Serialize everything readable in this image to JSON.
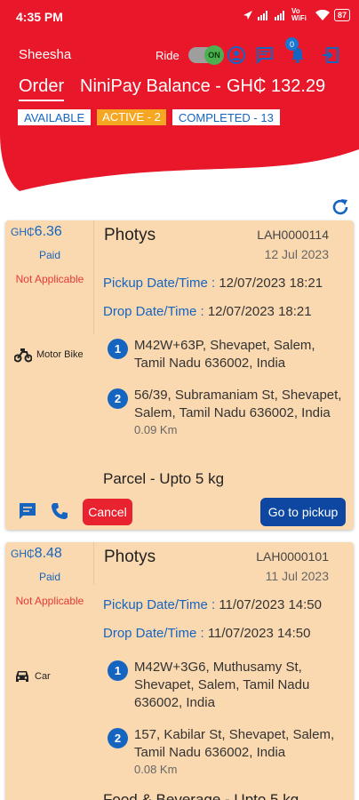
{
  "status_bar": {
    "time": "4:35 PM",
    "network": "Vo WiFi",
    "battery": "87"
  },
  "header": {
    "app_name": "Sheesha",
    "ride_label": "Ride",
    "toggle_label": "ON",
    "notification_count": "0",
    "order_tab": "Order",
    "balance_label": "NiniPay Balance -",
    "balance_value": "GH₵ 132.29",
    "chips": {
      "available": "AVAILABLE",
      "active": "ACTIVE - 2",
      "completed": "COMPLETED - 13"
    }
  },
  "orders": [
    {
      "currency": "GH₵",
      "amount": "6.36",
      "payment_status": "Paid",
      "applicability": "Not Applicable",
      "vehicle": "Motor Bike",
      "vehicle_icon": "motorbike-icon",
      "customer": "Photys",
      "order_id": "LAH0000114",
      "order_date": "12 Jul 2023",
      "pickup_label": "Pickup Date/Time :",
      "pickup_value": "12/07/2023 18:21",
      "drop_label": "Drop Date/Time :",
      "drop_value": "12/07/2023 18:21",
      "address_1": {
        "num": "1",
        "text": "M42W+63P, Shevapet, Salem, Tamil Nadu 636002, India"
      },
      "address_2": {
        "num": "2",
        "text": "56/39, Subramaniam St, Shevapet, Salem, Tamil Nadu 636002, India",
        "distance": "0.09 Km"
      },
      "parcel": "Parcel - Upto 5 kg",
      "cancel_label": "Cancel",
      "pickup_button_label": "Go to pickup"
    },
    {
      "currency": "GH₵",
      "amount": "8.48",
      "payment_status": "Paid",
      "applicability": "Not Applicable",
      "vehicle": "Car",
      "vehicle_icon": "car-icon",
      "customer": "Photys",
      "order_id": "LAH0000101",
      "order_date": "11 Jul 2023",
      "pickup_label": "Pickup Date/Time :",
      "pickup_value": "11/07/2023 14:50",
      "drop_label": "Drop Date/Time :",
      "drop_value": "11/07/2023 14:50",
      "address_1": {
        "num": "1",
        "text": "M42W+3G6, Muthusamy St, Shevapet, Salem, Tamil Nadu 636002, India"
      },
      "address_2": {
        "num": "2",
        "text": "157, Kabilar St, Shevapet, Salem, Tamil Nadu 636002, India",
        "distance": "0.08 Km"
      },
      "parcel": "Food & Beverage - Upto 5 kg"
    }
  ],
  "colors": {
    "brand_red": "#e8182a",
    "card_bg": "#fbd9b0",
    "accent_blue": "#1565c0",
    "active_orange": "#f5a623"
  }
}
